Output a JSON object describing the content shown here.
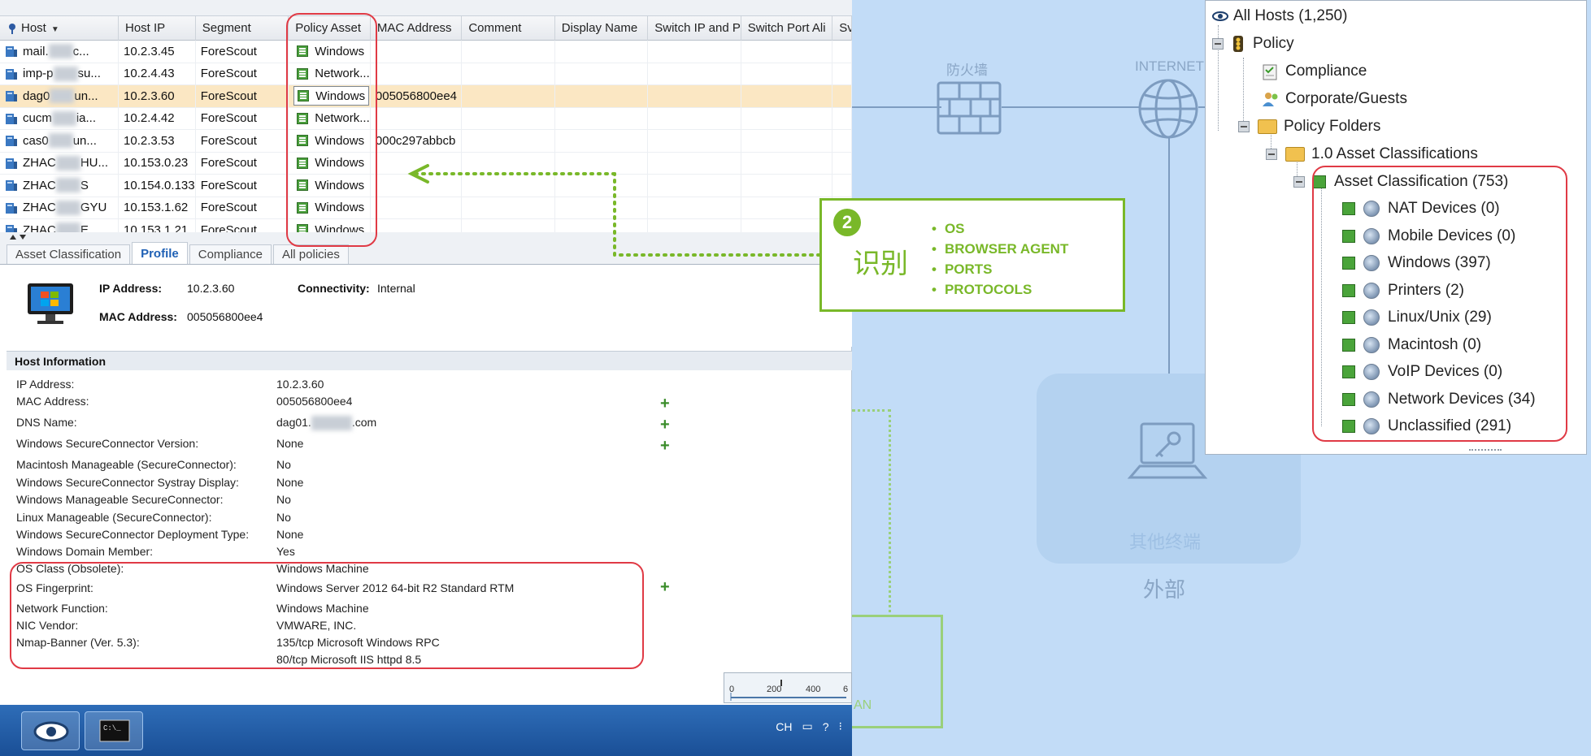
{
  "table": {
    "columns": [
      "Host",
      "Host IP",
      "Segment",
      "Policy Asset",
      "MAC Address",
      "Comment",
      "Display Name",
      "Switch IP and P",
      "Switch Port Ali",
      "Sv"
    ],
    "rows": [
      {
        "host_a": "mail.",
        "host_b": "c...",
        "ip": "10.2.3.45",
        "segment": "ForeScout",
        "policy": "Windows",
        "mac": ""
      },
      {
        "host_a": "imp-p",
        "host_b": "su...",
        "ip": "10.2.4.43",
        "segment": "ForeScout",
        "policy": "Network...",
        "mac": ""
      },
      {
        "host_a": "dag0",
        "host_b": "un...",
        "ip": "10.2.3.60",
        "segment": "ForeScout",
        "policy": "Windows",
        "mac": "005056800ee4",
        "selected": true
      },
      {
        "host_a": "cucm",
        "host_b": "ia...",
        "ip": "10.2.4.42",
        "segment": "ForeScout",
        "policy": "Network...",
        "mac": ""
      },
      {
        "host_a": "cas0",
        "host_b": "un...",
        "ip": "10.2.3.53",
        "segment": "ForeScout",
        "policy": "Windows",
        "mac": "000c297abbcb"
      },
      {
        "host_a": "ZHAC",
        "host_b": "HU...",
        "ip": "10.153.0.23",
        "segment": "ForeScout",
        "policy": "Windows",
        "mac": ""
      },
      {
        "host_a": "ZHAC",
        "host_b": "S",
        "ip": "10.154.0.133",
        "segment": "ForeScout",
        "policy": "Windows",
        "mac": ""
      },
      {
        "host_a": "ZHAC",
        "host_b": "GYU",
        "ip": "10.153.1.62",
        "segment": "ForeScout",
        "policy": "Windows",
        "mac": ""
      },
      {
        "host_a": "ZHAC",
        "host_b": "E",
        "ip": "10.153.1.21",
        "segment": "ForeScout",
        "policy": "Windows",
        "mac": ""
      }
    ]
  },
  "tabs": [
    "Asset Classification",
    "Profile",
    "Compliance",
    "All policies"
  ],
  "profile": {
    "ip_label": "IP Address:",
    "ip_value": "10.2.3.60",
    "conn_label": "Connectivity:",
    "conn_value": "Internal",
    "mac_label": "MAC Address:",
    "mac_value": "005056800ee4"
  },
  "host_info": {
    "header": "Host Information",
    "items": [
      {
        "label": "IP Address:",
        "value": "10.2.3.60"
      },
      {
        "label": "MAC Address:",
        "value": "005056800ee4"
      },
      {
        "label": "DNS Name:",
        "value": "dag01.",
        "value_suffix": ".com"
      },
      {
        "label": "Windows SecureConnector Version:",
        "value": "None"
      },
      {
        "label": "Macintosh Manageable (SecureConnector):",
        "value": "No"
      },
      {
        "label": "Windows SecureConnector Systray Display:",
        "value": "None"
      },
      {
        "label": "Windows Manageable SecureConnector:",
        "value": "No"
      },
      {
        "label": "Linux Manageable (SecureConnector):",
        "value": "No"
      },
      {
        "label": "Windows SecureConnector Deployment Type:",
        "value": "None"
      },
      {
        "label": "Windows Domain Member:",
        "value": "Yes"
      },
      {
        "label": "OS Class (Obsolete):",
        "value": "Windows Machine"
      },
      {
        "label": "OS Fingerprint:",
        "value": "Windows Server 2012 64-bit R2 Standard RTM"
      },
      {
        "label": "Network Function:",
        "value": "Windows Machine"
      },
      {
        "label": "NIC Vendor:",
        "value": "VMWARE, INC."
      },
      {
        "label": "Nmap-Banner (Ver. 5.3):",
        "value": "135/tcp Microsoft Windows RPC"
      },
      {
        "label": "",
        "value": "80/tcp Microsoft IIS httpd 8.5"
      }
    ]
  },
  "scale": {
    "ticks": [
      "0",
      "200",
      "400",
      "6"
    ]
  },
  "taskbar": {
    "tray_lang": "CH"
  },
  "diagram": {
    "firewall_label": "防火墙",
    "internet_label": "INTERNET",
    "other_endpoints": "其他终端",
    "external": "外部",
    "lan_fragment": "AN"
  },
  "callout": {
    "badge": "2",
    "title": "识别",
    "items": [
      "OS",
      "BROWSER AGENT",
      "PORTS",
      "PROTOCOLS"
    ]
  },
  "tree": {
    "all_hosts": "All Hosts (1,250)",
    "policy": "Policy",
    "compliance": "Compliance",
    "corporate_guests": "Corporate/Guests",
    "policy_folders": "Policy Folders",
    "asset_folder": "1.0 Asset Classifications",
    "asset_classification": "Asset Classification (753)",
    "children": [
      "NAT Devices (0)",
      "Mobile Devices (0)",
      "Windows (397)",
      "Printers (2)",
      "Linux/Unix (29)",
      "Macintosh (0)",
      "VoIP Devices (0)",
      "Network Devices (34)",
      "Unclassified (291)"
    ]
  },
  "colors": {
    "accent_green": "#79b829",
    "highlight_red": "#e03a45",
    "selected_row": "#fbe7c3"
  }
}
